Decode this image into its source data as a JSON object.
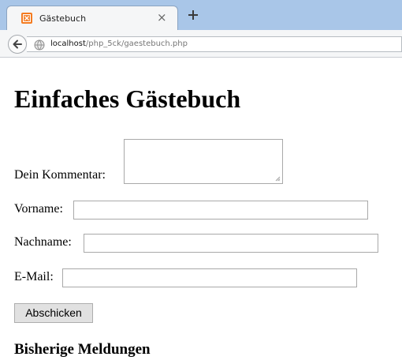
{
  "browser": {
    "tab": {
      "title": "Gästebuch",
      "close_symbol": "×",
      "favicon": "xampp-favicon-icon"
    },
    "new_tab_icon": "plus-icon",
    "back_icon": "back-arrow-icon",
    "site_icon": "globe-icon",
    "url": {
      "host": "localhost",
      "path": "/php_5ck/gaestebuch.php"
    }
  },
  "page": {
    "title": "Einfaches Gästebuch",
    "form": {
      "comment_label": "Dein Kommentar:",
      "comment_value": "",
      "firstname_label": "Vorname:",
      "firstname_value": "",
      "lastname_label": "Nachname:",
      "lastname_value": "",
      "email_label": "E-Mail:",
      "email_value": "",
      "submit_label": "Abschicken"
    },
    "messages_heading": "Bisherige Meldungen"
  },
  "colors": {
    "tabstrip": "#a9c6e8",
    "toolbar": "#f5f6f7",
    "favicon": "#f47b20"
  }
}
